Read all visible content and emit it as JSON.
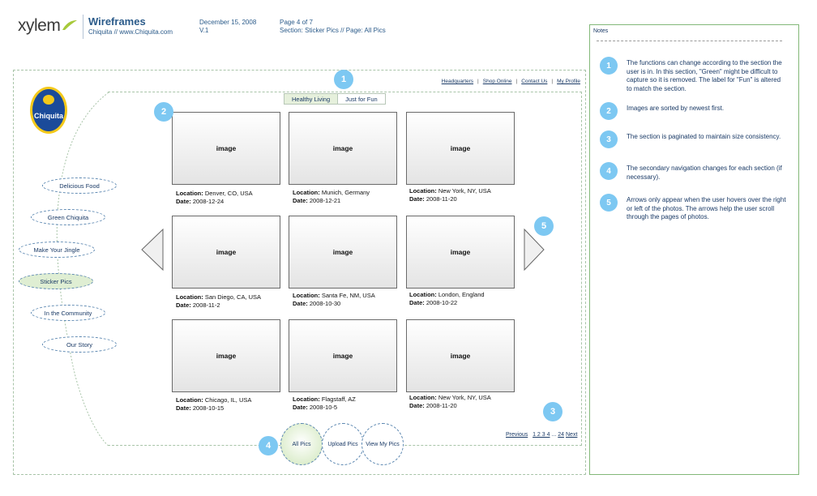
{
  "header": {
    "logo": "xylem",
    "title": "Wireframes",
    "subtitle": "Chiquita // www.Chiquita.com",
    "date": "December 15, 2008",
    "version": "V.1",
    "page": "Page 4 of 7",
    "section": "Section: Sticker Pics // Page: All Pics"
  },
  "util_nav": [
    "Headquarters",
    "Shop Online",
    "Contact Us",
    "My Profile"
  ],
  "brand_logo": "Chiquita",
  "tabs": [
    "Healthy Living",
    "Just for Fun"
  ],
  "side_nav": [
    "Delicious Food",
    "Green Chiquita",
    "Make Your Jingle",
    "Sticker Pics",
    "In the Community",
    "Our Story"
  ],
  "grid": {
    "image_label": "image",
    "location_label": "Location:",
    "date_label": "Date:",
    "items": [
      {
        "location": "Denver, CO, USA",
        "date": "2008-12-24"
      },
      {
        "location": "Munich, Germany",
        "date": "2008-12-21"
      },
      {
        "location": "New York, NY, USA",
        "date": "2008-11-20"
      },
      {
        "location": "San Diego, CA, USA",
        "date": "2008-11-2"
      },
      {
        "location": "Santa Fe, NM, USA",
        "date": "2008-10-30"
      },
      {
        "location": "London, England",
        "date": "2008-10-22"
      },
      {
        "location": "Chicago, IL, USA",
        "date": "2008-10-15"
      },
      {
        "location": "Flagstaff, AZ",
        "date": "2008-10-5"
      },
      {
        "location": "New York, NY, USA",
        "date": "2008-11-20"
      }
    ]
  },
  "pagination": {
    "previous": "Previous",
    "pages": "1 2 3 4",
    "ellipsis": "...",
    "last": "24",
    "next": "Next"
  },
  "bottom_buttons": [
    "All Pics",
    "Upload Pics",
    "View My Pics"
  ],
  "callouts": [
    "1",
    "2",
    "3",
    "4",
    "5"
  ],
  "notes": {
    "title": "Notes",
    "items": [
      {
        "num": "1",
        "text": "The functions can change according to the section the user is in. In this section, \"Green\" might be difficult to capture so it is removed. The label for \"Fun\" is altered to match the section."
      },
      {
        "num": "2",
        "text": "Images are sorted by newest first."
      },
      {
        "num": "3",
        "text": "The section is paginated to maintain size consistency."
      },
      {
        "num": "4",
        "text": "The secondary navigation changes for each section (if necessary)."
      },
      {
        "num": "5",
        "text": "Arrows only appear when the user hovers over the right or left of the photos. The arrows help the user scroll through the pages of photos."
      }
    ]
  },
  "colors": {
    "accent_green": "#dfeed3",
    "callout_blue": "#7dc8f2",
    "text_navy": "#1a3a66",
    "brand_blue": "#1b4b9a",
    "brand_yellow": "#f4c91a"
  }
}
